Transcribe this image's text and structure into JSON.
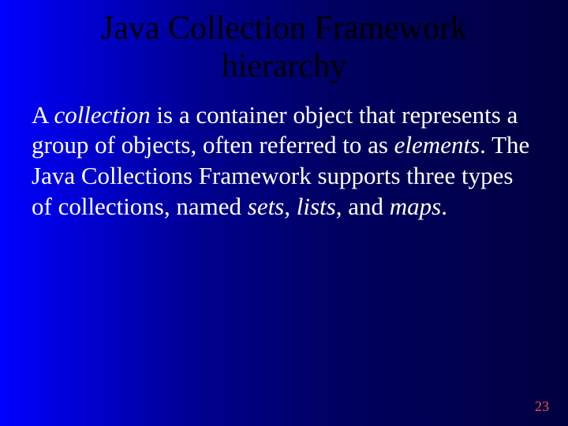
{
  "slide": {
    "title_line1": "Java Collection Framework",
    "title_line2": "hierarchy",
    "body_pre": "A ",
    "body_em1": "collection",
    "body_mid1": " is a container object that represents a group of objects, often referred to as ",
    "body_em2": "elements",
    "body_mid2": ". The Java Collections Framework supports three types of collections, named ",
    "body_em3": "sets,",
    "body_sp1": " ",
    "body_em4": "lists,",
    "body_mid3": " and ",
    "body_em5": "maps",
    "body_end": "."
  },
  "page_number": "23"
}
